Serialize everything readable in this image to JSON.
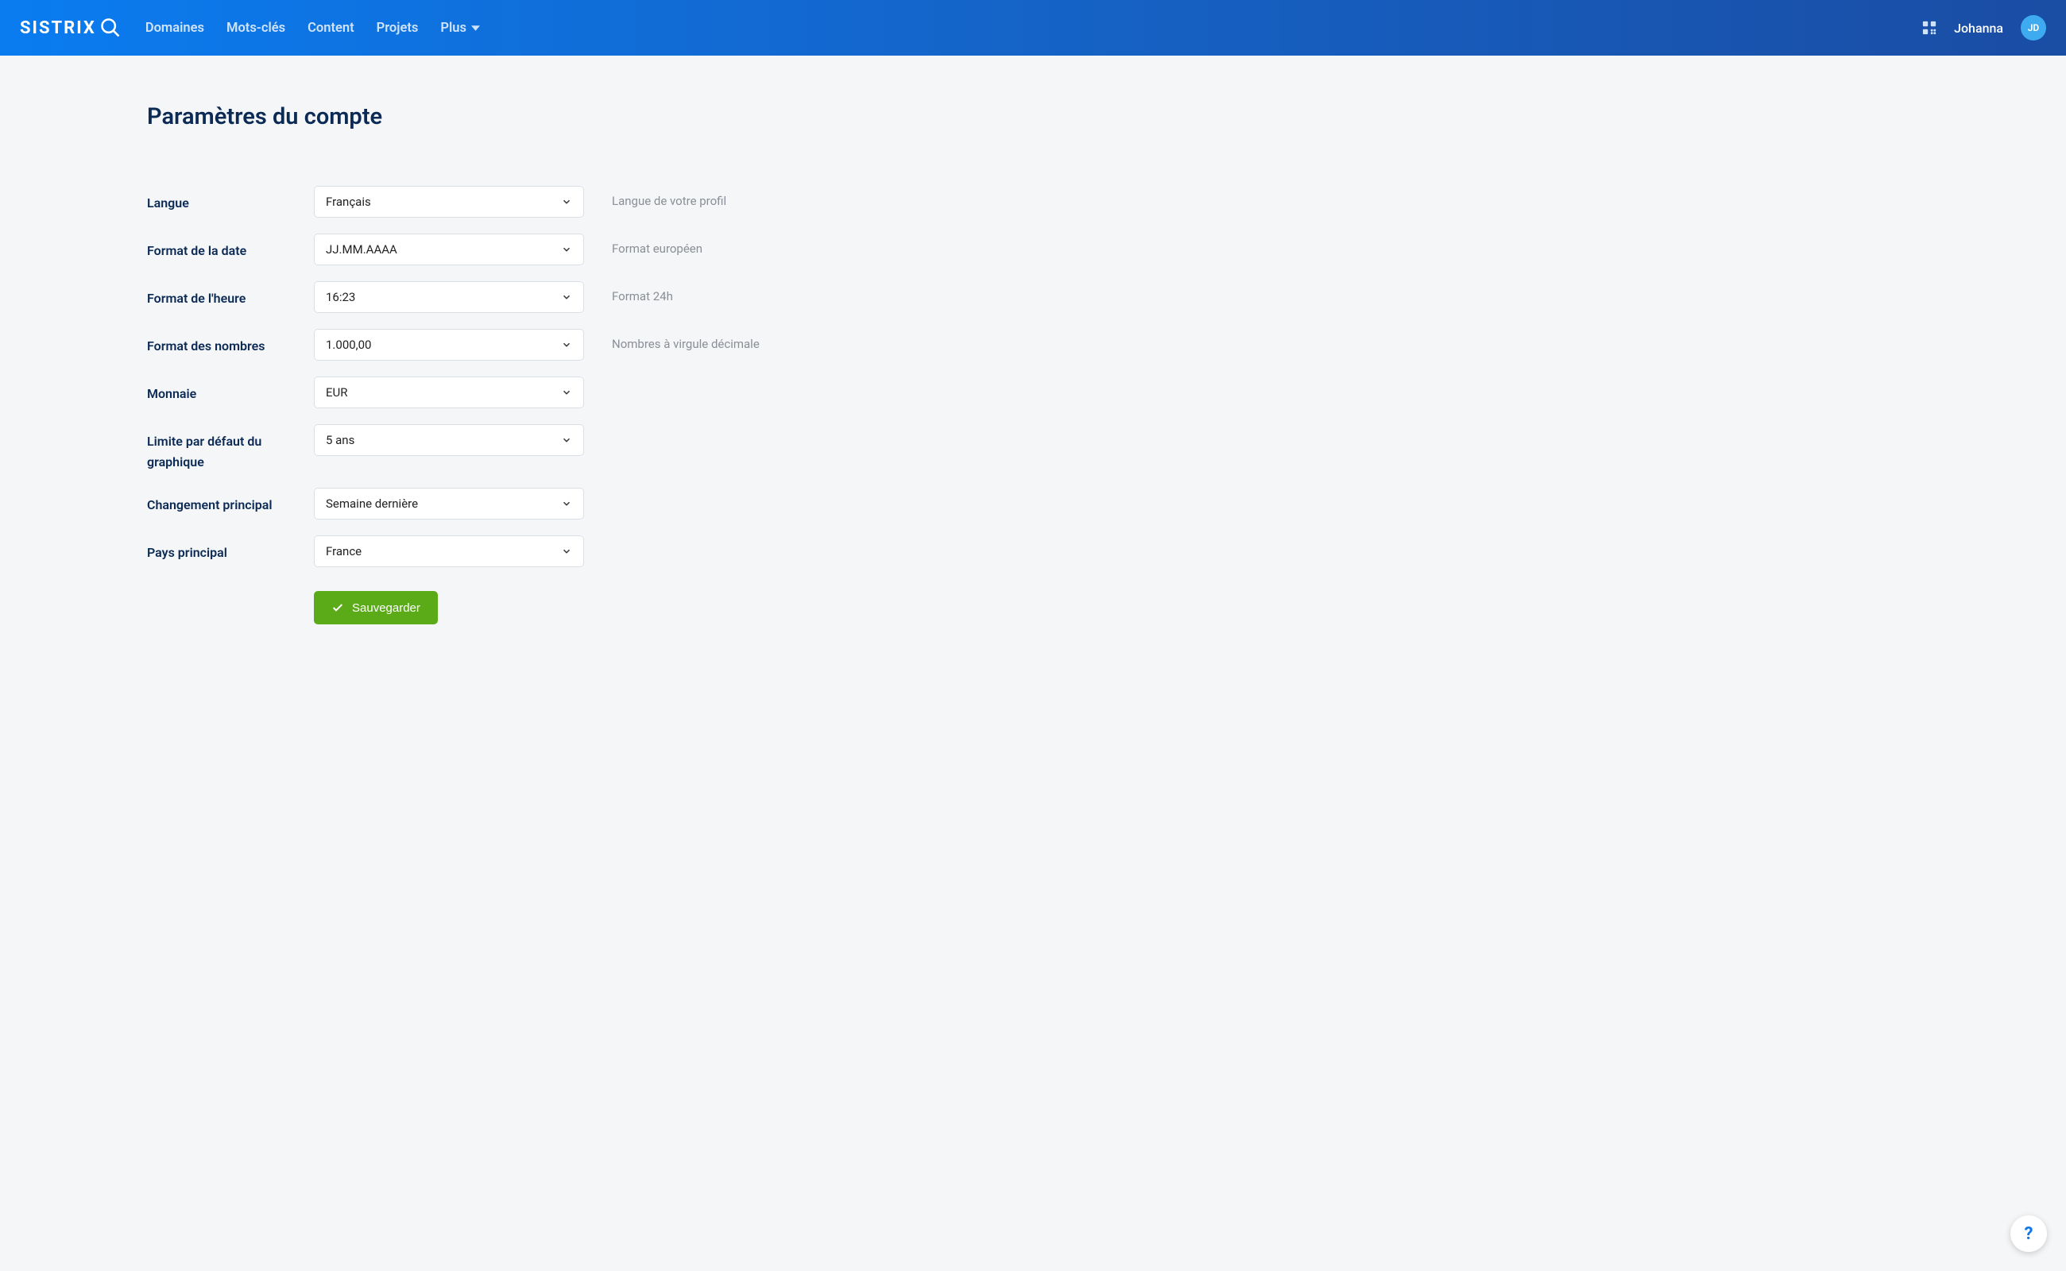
{
  "header": {
    "logo_text": "SISTRIX",
    "nav": {
      "domaines": "Domaines",
      "motscles": "Mots-clés",
      "content": "Content",
      "projets": "Projets",
      "plus": "Plus"
    },
    "user_name": "Johanna",
    "avatar_initials": "JD"
  },
  "page": {
    "title": "Paramètres du compte"
  },
  "form": {
    "langue": {
      "label": "Langue",
      "value": "Français",
      "help": "Langue de votre profil"
    },
    "date": {
      "label": "Format de la date",
      "value": "JJ.MM.AAAA",
      "help": "Format européen"
    },
    "heure": {
      "label": "Format de l'heure",
      "value": "16:23",
      "help": "Format 24h"
    },
    "nombres": {
      "label": "Format des nombres",
      "value": "1.000,00",
      "help": "Nombres à virgule décimale"
    },
    "monnaie": {
      "label": "Monnaie",
      "value": "EUR",
      "help": ""
    },
    "graphique": {
      "label": "Limite par défaut du graphique",
      "value": "5 ans",
      "help": ""
    },
    "changement": {
      "label": "Changement principal",
      "value": "Semaine dernière",
      "help": ""
    },
    "pays": {
      "label": "Pays principal",
      "value": "France",
      "help": ""
    },
    "save": "Sauvegarder"
  },
  "help_button": "?"
}
